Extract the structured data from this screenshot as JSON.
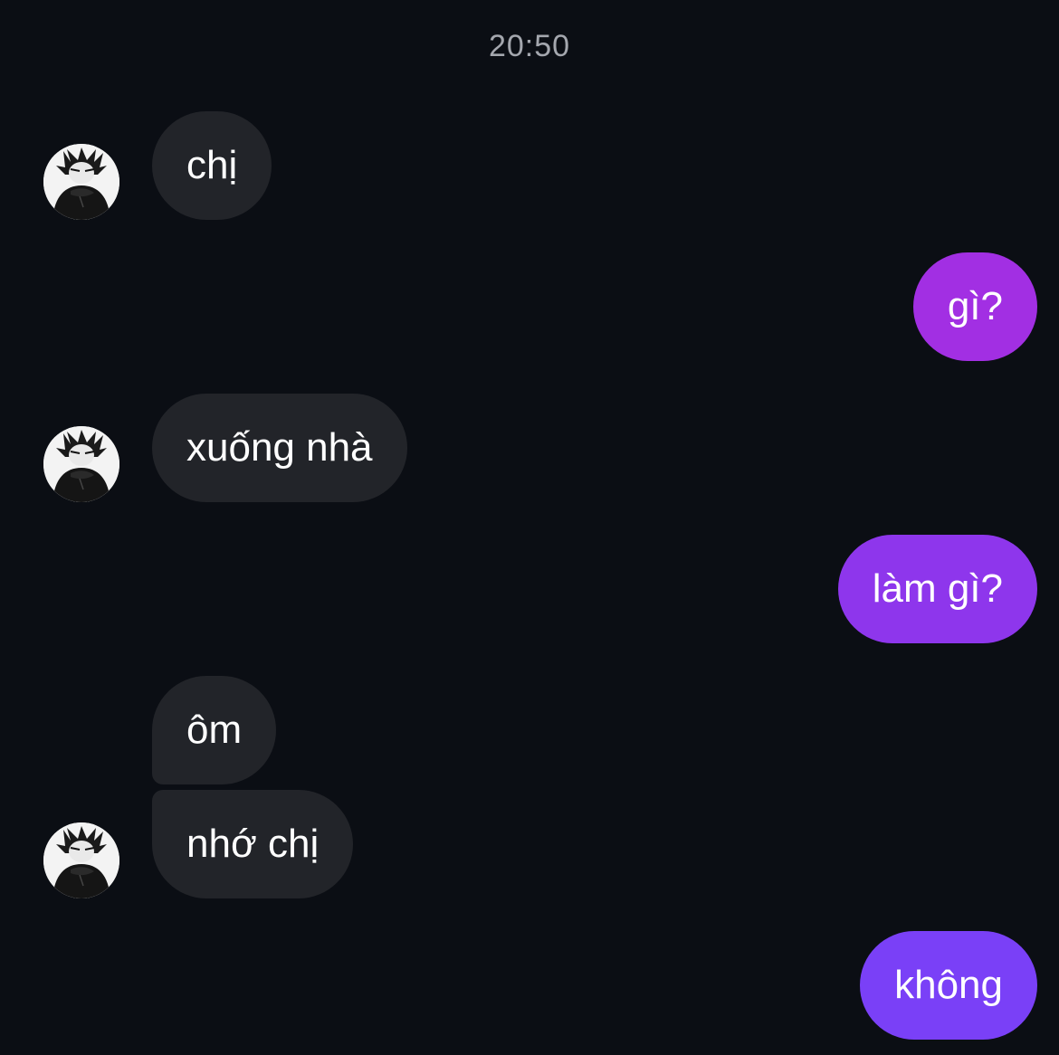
{
  "chat": {
    "timestamp": "20:50",
    "messages": [
      {
        "from": "them",
        "text": "chị"
      },
      {
        "from": "me",
        "text": "gì?"
      },
      {
        "from": "them",
        "text": "xuống nhà"
      },
      {
        "from": "me",
        "text": "làm gì?"
      },
      {
        "from": "them",
        "text": "ôm"
      },
      {
        "from": "them",
        "text": "nhớ chị"
      },
      {
        "from": "me",
        "text": "không"
      }
    ]
  },
  "colors": {
    "background": "#0b0e14",
    "incoming_bubble": "#222429",
    "outgoing_gradient_top": "#a52fe0",
    "outgoing_gradient_bottom": "#7a40f7",
    "timestamp_text": "#a4a7ae"
  },
  "icons": {
    "avatar": "contact-avatar-photo"
  }
}
